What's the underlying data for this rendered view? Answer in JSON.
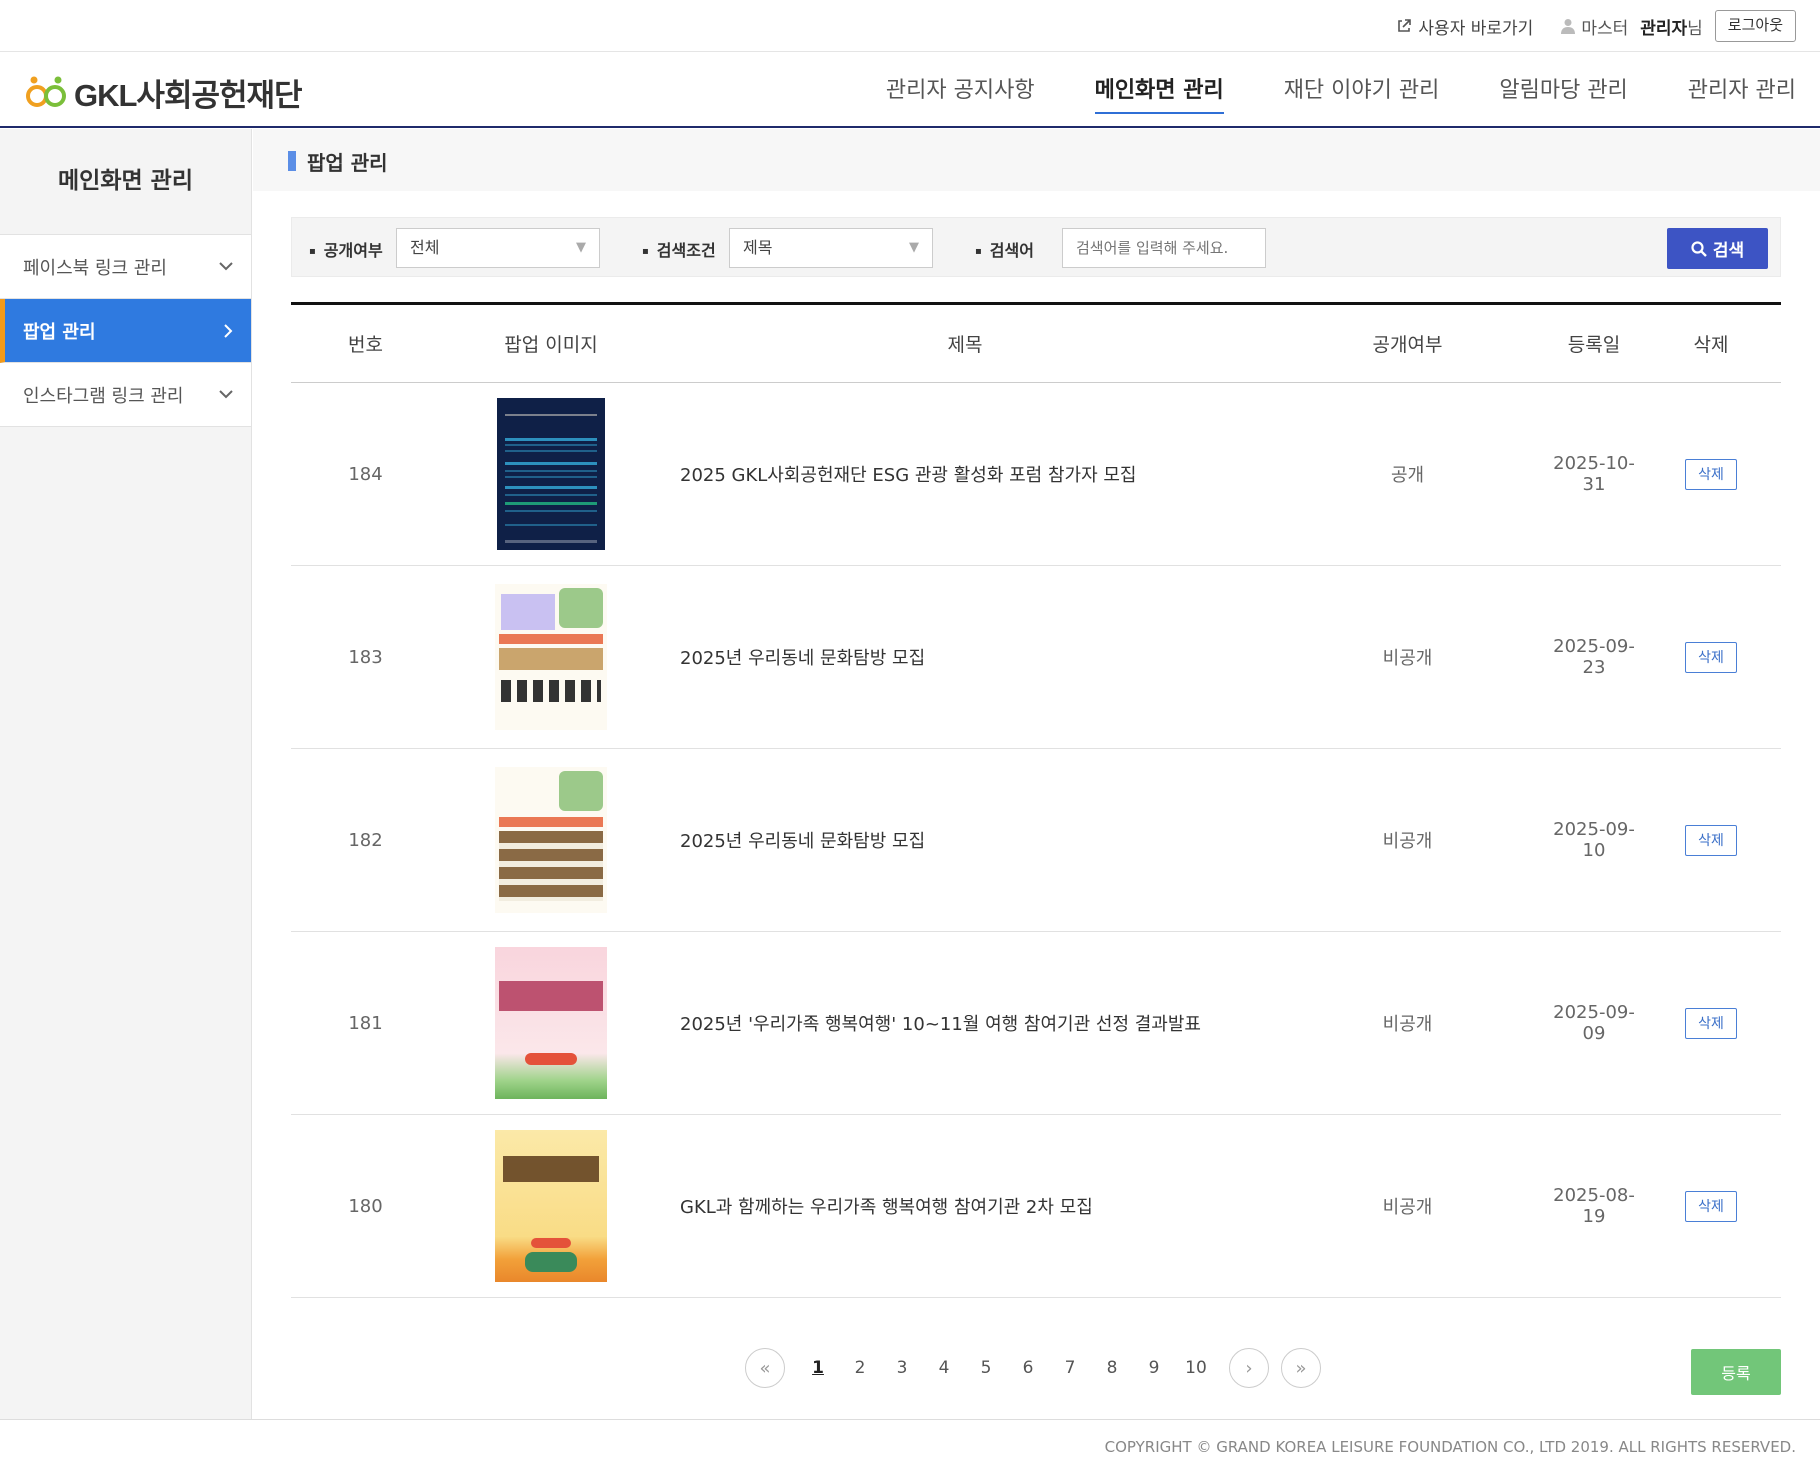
{
  "util": {
    "user_link": "사용자 바로가기",
    "role": "마스터",
    "user_name": "관리자",
    "user_suffix": "님",
    "logout": "로그아웃"
  },
  "logo": {
    "text": "GKL사회공헌재단"
  },
  "gnb": [
    "관리자 공지사항",
    "메인화면 관리",
    "재단 이야기 관리",
    "알림마당 관리",
    "관리자 관리"
  ],
  "sidebar": {
    "title": "메인화면 관리",
    "items": [
      {
        "label": "페이스북 링크 관리"
      },
      {
        "label": "팝업 관리"
      },
      {
        "label": "인스타그램 링크 관리"
      }
    ]
  },
  "page": {
    "title": "팝업 관리"
  },
  "search": {
    "open_label": "공개여부",
    "open_value": "전체",
    "cond_label": "검색조건",
    "cond_value": "제목",
    "keyword_label": "검색어",
    "keyword_placeholder": "검색어를 입력해 주세요.",
    "button": "검색"
  },
  "table": {
    "headers": [
      "번호",
      "팝업 이미지",
      "제목",
      "공개여부",
      "등록일",
      "삭제"
    ],
    "rows": [
      {
        "no": "184",
        "title": "2025 GKL사회공헌재단 ESG 관광 활성화 포럼 참가자 모집",
        "open": "공개",
        "date": "2025-10-31",
        "del": "삭제"
      },
      {
        "no": "183",
        "title": "2025년 우리동네 문화탐방 모집",
        "open": "비공개",
        "date": "2025-09-23",
        "del": "삭제"
      },
      {
        "no": "182",
        "title": "2025년 우리동네 문화탐방 모집",
        "open": "비공개",
        "date": "2025-09-10",
        "del": "삭제"
      },
      {
        "no": "181",
        "title": "2025년 '우리가족 행복여행' 10~11월 여행 참여기관 선정 결과발표",
        "open": "비공개",
        "date": "2025-09-09",
        "del": "삭제"
      },
      {
        "no": "180",
        "title": "GKL과 함께하는 우리가족 행복여행 참여기관 2차 모집",
        "open": "비공개",
        "date": "2025-08-19",
        "del": "삭제"
      }
    ]
  },
  "pagination": {
    "pages": [
      "1",
      "2",
      "3",
      "4",
      "5",
      "6",
      "7",
      "8",
      "9",
      "10"
    ],
    "current": "1"
  },
  "register": "등록",
  "footer": "COPYRIGHT © GRAND KOREA LEISURE FOUNDATION CO., LTD 2019. ALL RIGHTS RESERVED.",
  "thumbs": {
    "t182": {
      "year": "2025",
      "name": "우리동네 문화탐방"
    },
    "t181": {
      "line1": "우리가족 행복여행",
      "line2": "참여기관 선정결과 발표"
    },
    "t180": {
      "line1": "2025 우리가족 행복여행",
      "line2": "참여기관 공개모집"
    }
  },
  "colors": {
    "accent": "#2f7ae0",
    "search_btn": "#3d54c4",
    "register_btn": "#72c679",
    "sidebar_marker": "#f29a1a"
  }
}
